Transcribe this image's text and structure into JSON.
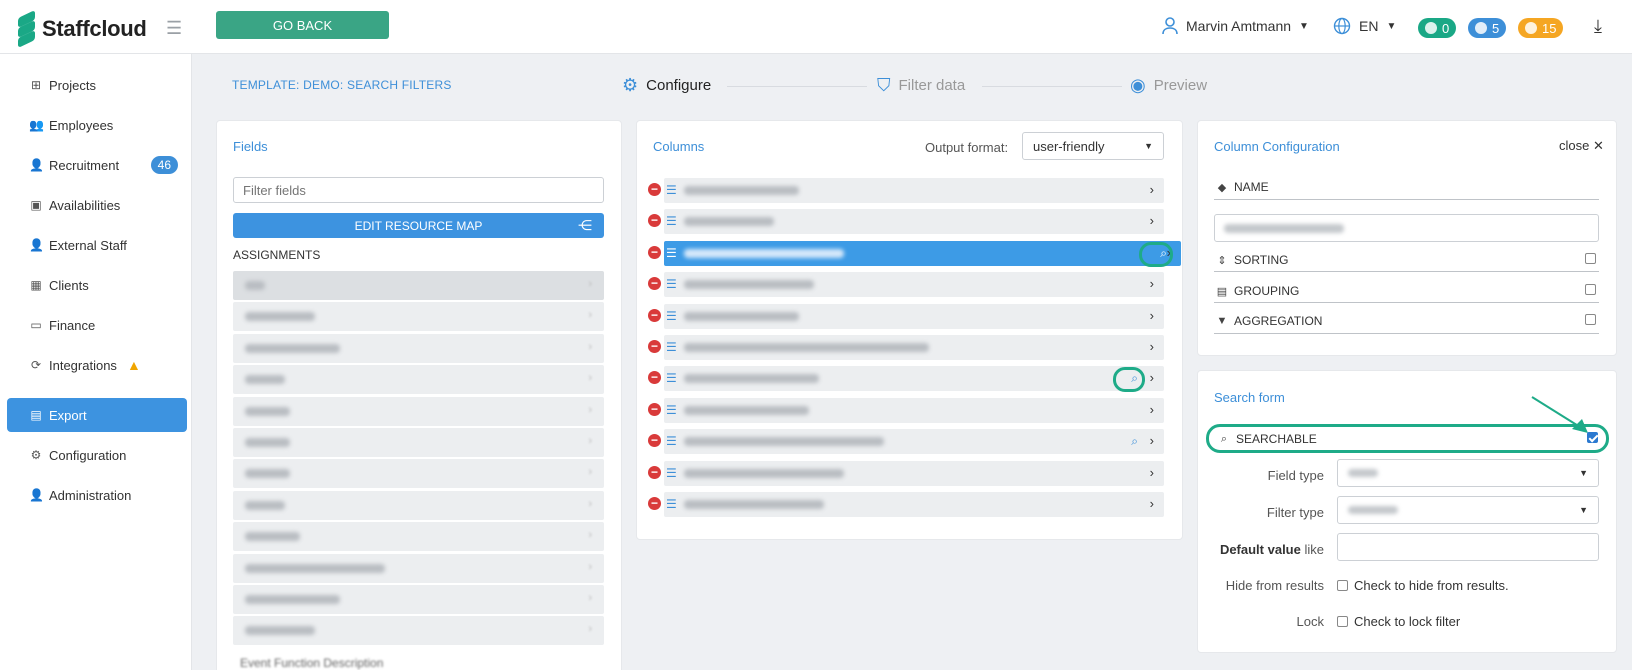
{
  "app": {
    "name": "Staffcloud"
  },
  "header": {
    "go_back": "GO BACK",
    "user": "Marvin Amtmann",
    "lang": "EN",
    "counters": [
      {
        "value": "0",
        "color": "#1aa886",
        "icon": "chat-icon"
      },
      {
        "value": "5",
        "color": "#3d8fd8",
        "icon": "bell-icon"
      },
      {
        "value": "15",
        "color": "#f5a623",
        "icon": "clock-icon"
      }
    ]
  },
  "sidebar": {
    "items": [
      {
        "label": "Projects",
        "icon": "sitemap-icon"
      },
      {
        "label": "Employees",
        "icon": "users-icon"
      },
      {
        "label": "Recruitment",
        "icon": "user-plus-icon",
        "badge": "46"
      },
      {
        "label": "Availabilities",
        "icon": "calendar-check-icon"
      },
      {
        "label": "External Staff",
        "icon": "user-icon"
      },
      {
        "label": "Clients",
        "icon": "building-icon"
      },
      {
        "label": "Finance",
        "icon": "money-icon"
      },
      {
        "label": "Integrations",
        "icon": "sync-icon",
        "warning": true
      },
      {
        "label": "Export",
        "icon": "file-icon",
        "active": true
      },
      {
        "label": "Configuration",
        "icon": "gear-icon"
      },
      {
        "label": "Administration",
        "icon": "user-gear-icon"
      }
    ]
  },
  "page": {
    "template_title": "TEMPLATE: DEMO: SEARCH FILTERS",
    "steps": [
      {
        "label": "Configure",
        "icon": "gear-icon",
        "active": true
      },
      {
        "label": "Filter data",
        "icon": "shield-search-icon"
      },
      {
        "label": "Preview",
        "icon": "eye-icon"
      }
    ]
  },
  "fields_panel": {
    "title": "Fields",
    "filter_placeholder": "Filter fields",
    "edit_button": "EDIT RESOURCE MAP",
    "section": "ASSIGNMENTS",
    "last_item": "Event Function Description"
  },
  "columns_panel": {
    "title": "Columns",
    "output_label": "Output format:",
    "output_value": "user-friendly"
  },
  "column_config": {
    "title": "Column Configuration",
    "close": "close",
    "name_label": "NAME",
    "sorting": "SORTING",
    "grouping": "GROUPING",
    "aggregation": "AGGREGATION"
  },
  "search_form": {
    "title": "Search form",
    "searchable": "SEARCHABLE",
    "searchable_checked": true,
    "field_type": "Field type",
    "filter_type": "Filter type",
    "default_value": "Default value",
    "default_value_suffix": "like",
    "hide_label": "Hide from results",
    "hide_check": "Check to hide from results.",
    "lock_label": "Lock",
    "lock_check": "Check to lock filter"
  }
}
